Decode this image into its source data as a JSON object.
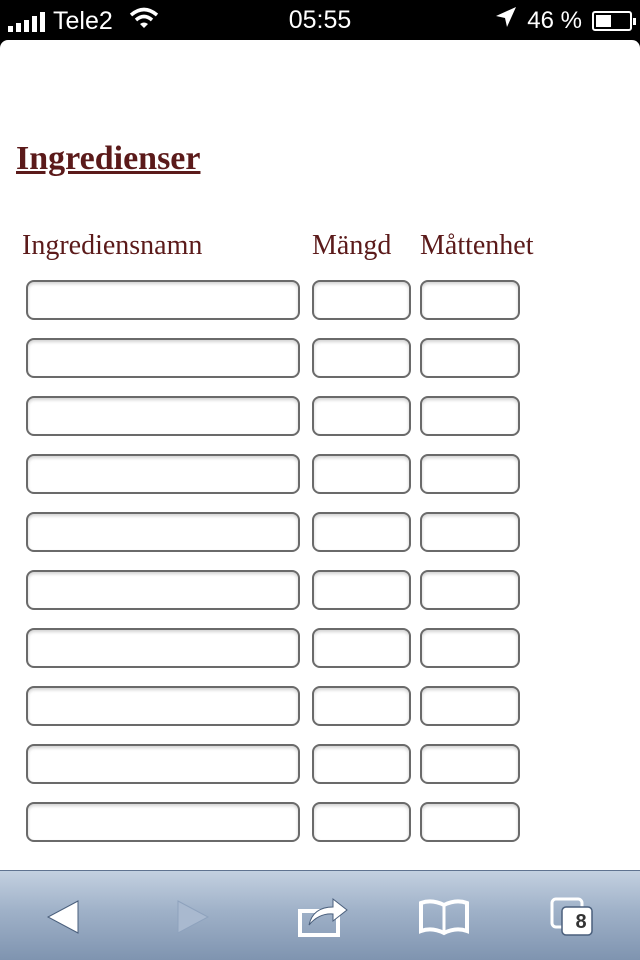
{
  "status_bar": {
    "carrier": "Tele2",
    "time": "05:55",
    "battery_percent": "46 %",
    "battery_level": 0.46
  },
  "page": {
    "title": "Ingredienser",
    "columns": {
      "name": "Ingrediensnamn",
      "amount": "Mängd",
      "unit": "Måttenhet"
    },
    "rows": [
      {
        "name": "",
        "amount": "",
        "unit": ""
      },
      {
        "name": "",
        "amount": "",
        "unit": ""
      },
      {
        "name": "",
        "amount": "",
        "unit": ""
      },
      {
        "name": "",
        "amount": "",
        "unit": ""
      },
      {
        "name": "",
        "amount": "",
        "unit": ""
      },
      {
        "name": "",
        "amount": "",
        "unit": ""
      },
      {
        "name": "",
        "amount": "",
        "unit": ""
      },
      {
        "name": "",
        "amount": "",
        "unit": ""
      },
      {
        "name": "",
        "amount": "",
        "unit": ""
      },
      {
        "name": "",
        "amount": "",
        "unit": ""
      }
    ]
  },
  "toolbar": {
    "tabs_count": "8",
    "icons": [
      "back-arrow-icon",
      "forward-arrow-icon",
      "share-icon",
      "bookmarks-icon",
      "tabs-icon"
    ]
  },
  "colors": {
    "heading": "#5b1a1a",
    "toolbar_top": "#c3d0e0",
    "toolbar_bottom": "#7f94b0"
  }
}
